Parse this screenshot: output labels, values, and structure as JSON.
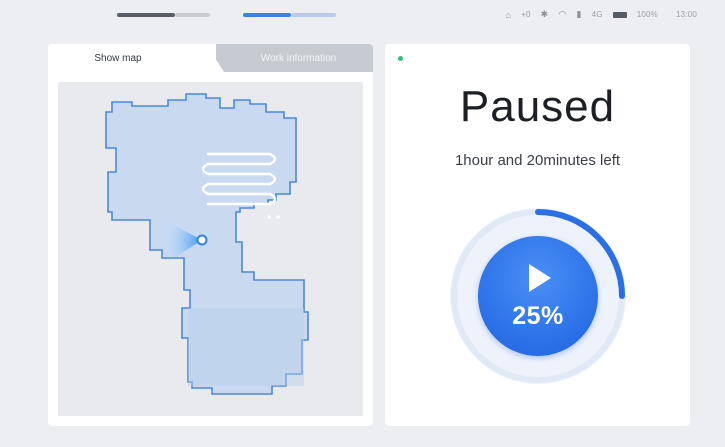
{
  "status_bar": {
    "indicators": [
      "blurred-segment-dark",
      "blurred-segment-blue"
    ],
    "items": [
      {
        "icon": "robot-icon",
        "text": "+0"
      },
      {
        "icon": "bluetooth-icon",
        "text": ""
      },
      {
        "icon": "wifi-icon",
        "text": ""
      },
      {
        "icon": "signal-icon",
        "text": "4G"
      },
      {
        "icon": "battery-icon",
        "text": "100%"
      }
    ],
    "time": "13:00"
  },
  "tabs": {
    "active": "Show map",
    "inactive": "Work information"
  },
  "status": {
    "title": "Paused",
    "remaining": "1hour and 20minutes left",
    "progress_percent": 25,
    "progress_label": "25%",
    "indicator_color": "#2ec27e"
  },
  "colors": {
    "accent": "#2a6fe6",
    "map_fill": "#c9daf0",
    "map_border": "#4a88e0"
  }
}
